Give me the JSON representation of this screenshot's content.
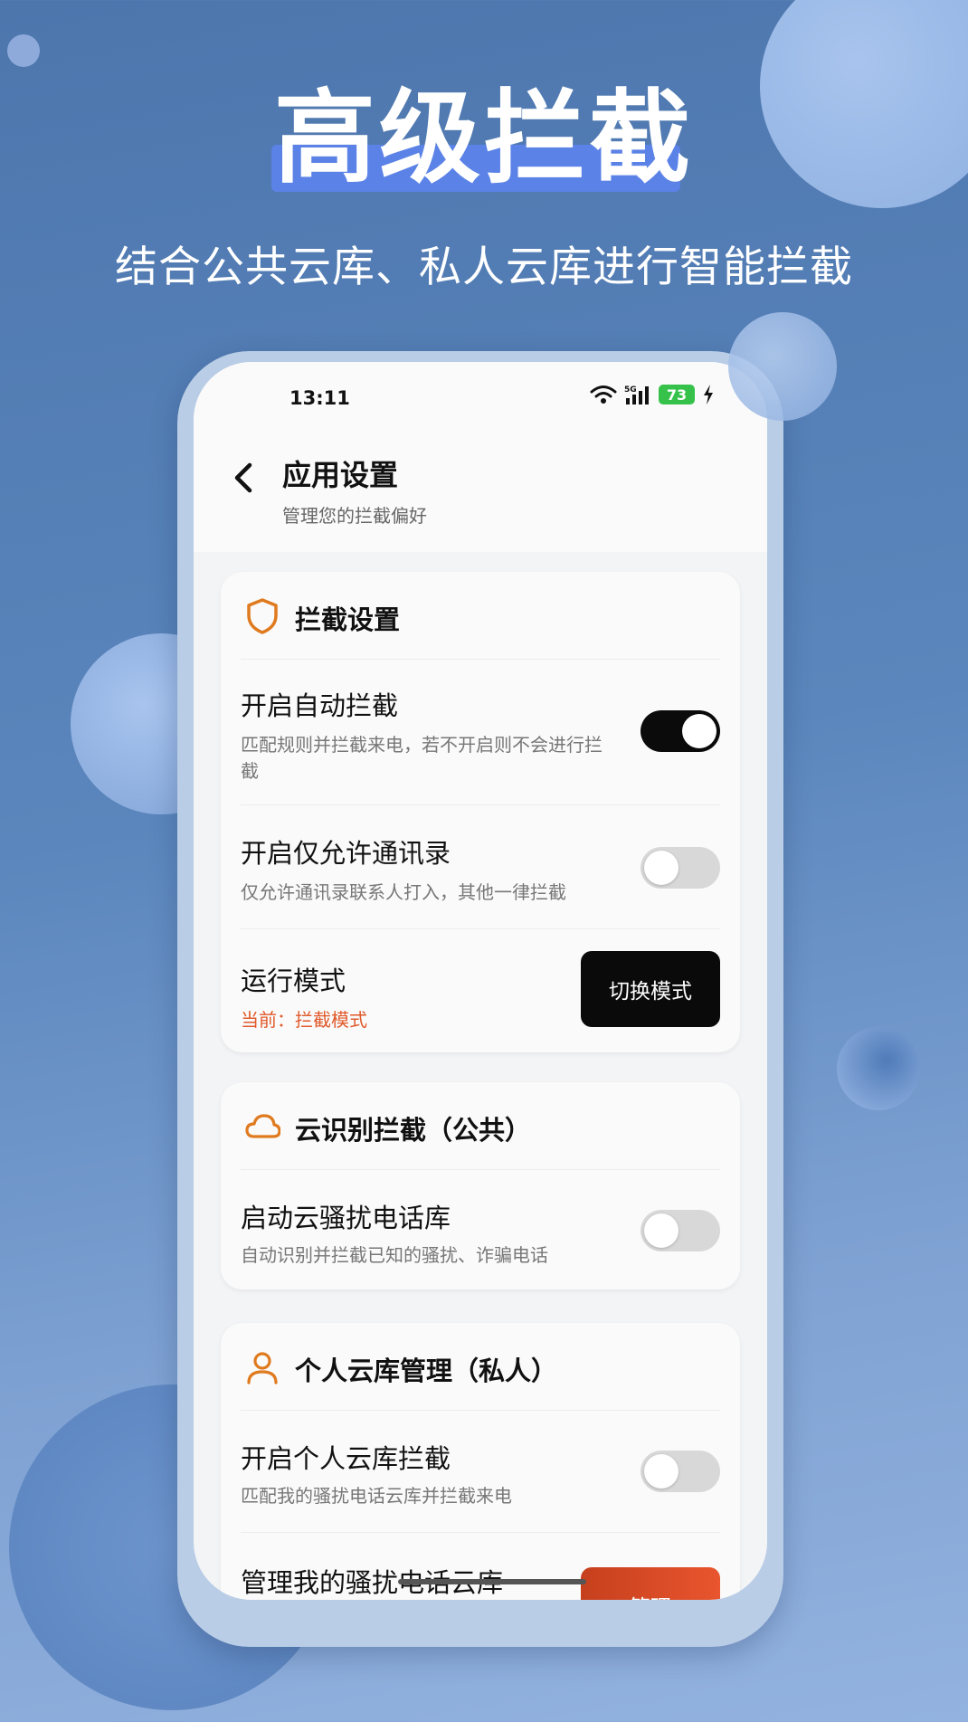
{
  "promo": {
    "headline": "高级拦截",
    "subtitle": "结合公共云库、私人云库进行智能拦截",
    "accent_color": "#5b82e6"
  },
  "statusbar": {
    "time": "13:11",
    "battery": "73",
    "network": "5G"
  },
  "header": {
    "title": "应用设置",
    "subtitle": "管理您的拦截偏好"
  },
  "sections": {
    "intercept": {
      "title": "拦截设置",
      "icon": "shield-icon",
      "auto_block": {
        "title": "开启自动拦截",
        "desc": "匹配规则并拦截来电，若不开启则不会进行拦截",
        "enabled": true
      },
      "contacts_only": {
        "title": "开启仅允许通讯录",
        "desc": "仅允许通讯录联系人打入，其他一律拦截",
        "enabled": false
      },
      "run_mode": {
        "title": "运行模式",
        "current": "当前：拦截模式",
        "button": "切换模式"
      }
    },
    "cloud": {
      "title": "云识别拦截（公共）",
      "icon": "cloud-icon",
      "cloud_lib": {
        "title": "启动云骚扰电话库",
        "desc": "自动识别并拦截已知的骚扰、诈骗电话",
        "enabled": false
      }
    },
    "personal": {
      "title": "个人云库管理（私人）",
      "icon": "user-icon",
      "personal_block": {
        "title": "开启个人云库拦截",
        "desc": "匹配我的骚扰电话云库并拦截来电",
        "enabled": false
      },
      "manage": {
        "title": "管理我的骚扰电话云库",
        "button": "管理"
      }
    }
  },
  "colors": {
    "orange": "#e07a1f",
    "accent_red": "#e05a2b"
  }
}
